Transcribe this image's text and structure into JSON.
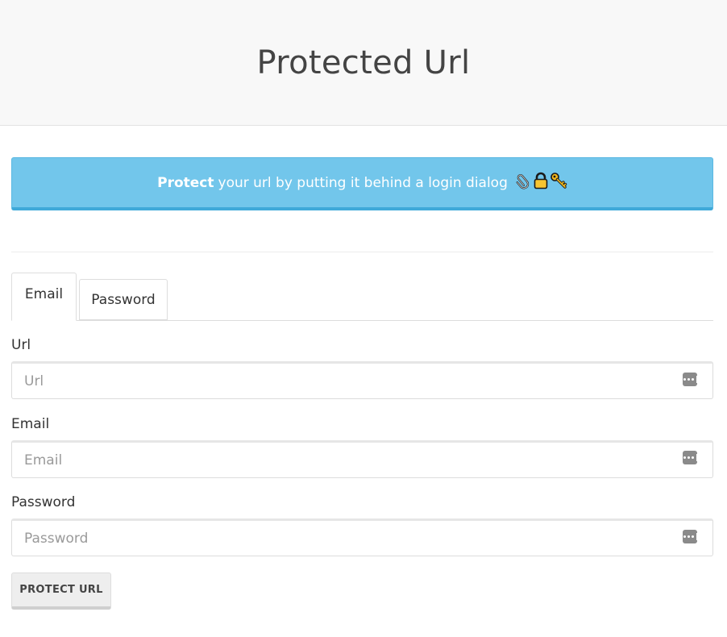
{
  "header": {
    "title": "Protected Url"
  },
  "banner": {
    "strong": "Protect",
    "text": "your url by putting it behind a login dialog",
    "icons": [
      "paperclip-icon",
      "lock-icon",
      "key-icon"
    ]
  },
  "tabs": [
    {
      "label": "Email",
      "active": true
    },
    {
      "label": "Password",
      "active": false
    }
  ],
  "form": {
    "url": {
      "label": "Url",
      "placeholder": "Url",
      "value": ""
    },
    "email": {
      "label": "Email",
      "placeholder": "Email",
      "value": ""
    },
    "password": {
      "label": "Password",
      "placeholder": "Password",
      "value": ""
    },
    "submit_label": "PROTECT URL"
  },
  "colors": {
    "banner_bg": "#72c6eb",
    "banner_border": "#3fa9d9",
    "header_bg": "#f8f8f8"
  }
}
